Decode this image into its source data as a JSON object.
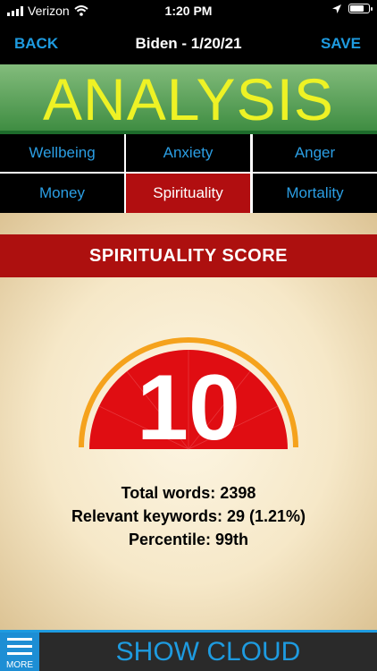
{
  "status_bar": {
    "carrier": "Verizon",
    "time": "1:20 PM"
  },
  "nav": {
    "back_label": "BACK",
    "title": "Biden - 1/20/21",
    "save_label": "SAVE"
  },
  "banner": {
    "title": "ANALYSIS"
  },
  "tabs": [
    {
      "label": "Wellbeing",
      "active": false
    },
    {
      "label": "Anxiety",
      "active": false
    },
    {
      "label": "Anger",
      "active": false
    },
    {
      "label": "Money",
      "active": false
    },
    {
      "label": "Spirituality",
      "active": true
    },
    {
      "label": "Mortality",
      "active": false
    }
  ],
  "score": {
    "header": "SPIRITUALITY SCORE",
    "value": "10",
    "total_words": "Total words: 2398",
    "relevant_keywords": "Relevant keywords: 29 (1.21%)",
    "percentile": "Percentile: 99th"
  },
  "footer": {
    "more_label": "MORE",
    "show_cloud_label": "SHOW CLOUD"
  },
  "colors": {
    "accent": "#1e9be0",
    "banner_text": "#eef225",
    "score_red": "#ad100f",
    "gauge_red": "#e00d12",
    "gauge_ring": "#f5a21c"
  }
}
